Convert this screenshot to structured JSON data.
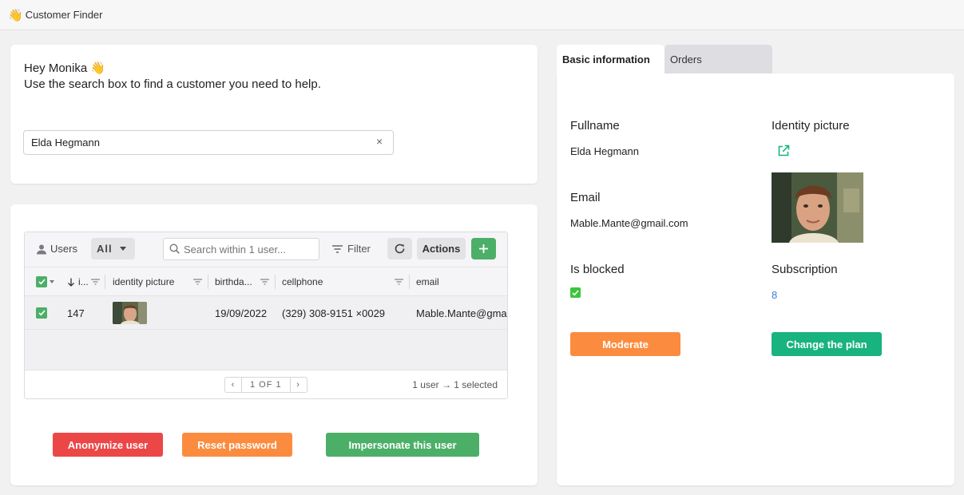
{
  "app": {
    "title": "Customer Finder",
    "title_emoji": "👋"
  },
  "greeting": {
    "line1": "Hey Monika 👋",
    "line2": "Use the search box to find a customer you need to help.",
    "search_value": "Elda Hegmann",
    "clear_symbol": "×"
  },
  "grid": {
    "toolbar": {
      "users_label": "Users",
      "filter_all": "All",
      "search_placeholder": "Search within 1 user...",
      "filter_label": "Filter",
      "actions_label": "Actions"
    },
    "columns": [
      "i...",
      "identity picture",
      "birthda...",
      "cellphone",
      "email"
    ],
    "rows": [
      {
        "id": "147",
        "birthdate": "19/09/2022",
        "cellphone": "(329) 308-9151 ×0029",
        "email": "Mable.Mante@gmail.com"
      }
    ],
    "pager": {
      "prev": "‹",
      "text": "1 OF 1",
      "next": "›"
    },
    "selection_info": "1 user → 1 selected"
  },
  "actions": {
    "anonymize": "Anonymize user",
    "reset_password": "Reset password",
    "impersonate": "Impersonate this user"
  },
  "tabs": {
    "basic": "Basic information",
    "orders": "Orders"
  },
  "details": {
    "fullname_label": "Fullname",
    "fullname": "Elda Hegmann",
    "identity_label": "Identity picture",
    "email_label": "Email",
    "email": "Mable.Mante@gmail.com",
    "blocked_label": "Is blocked",
    "blocked": true,
    "subscription_label": "Subscription",
    "subscription": "8",
    "moderate": "Moderate",
    "change_plan": "Change the plan"
  },
  "colors": {
    "green": "#4caf68",
    "red": "#ec4747",
    "orange": "#fb8c3f",
    "teal": "#18b37e",
    "link": "#3b7ed6"
  }
}
